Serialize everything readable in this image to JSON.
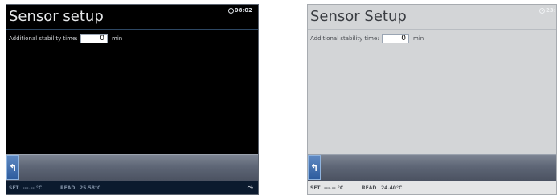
{
  "dark_screen": {
    "title": "Sensor setup",
    "time": "08:02",
    "stability_label": "Additional stability time:",
    "stability_value": "0",
    "stability_unit": "min",
    "back_icon": "back-arrow-icon",
    "status": {
      "set_label": "SET",
      "set_value": "---.-- °C",
      "read_label": "READ",
      "read_value": "25.58°C"
    }
  },
  "light_screen": {
    "title": "Sensor Setup",
    "time": "23:",
    "stability_label": "Additional stability time:",
    "stability_value": "0",
    "stability_unit": "min",
    "back_icon": "back-arrow-icon",
    "status": {
      "set_label": "SET",
      "set_value": "---.-- °C",
      "read_label": "READ",
      "read_value": "24.40°C"
    }
  }
}
